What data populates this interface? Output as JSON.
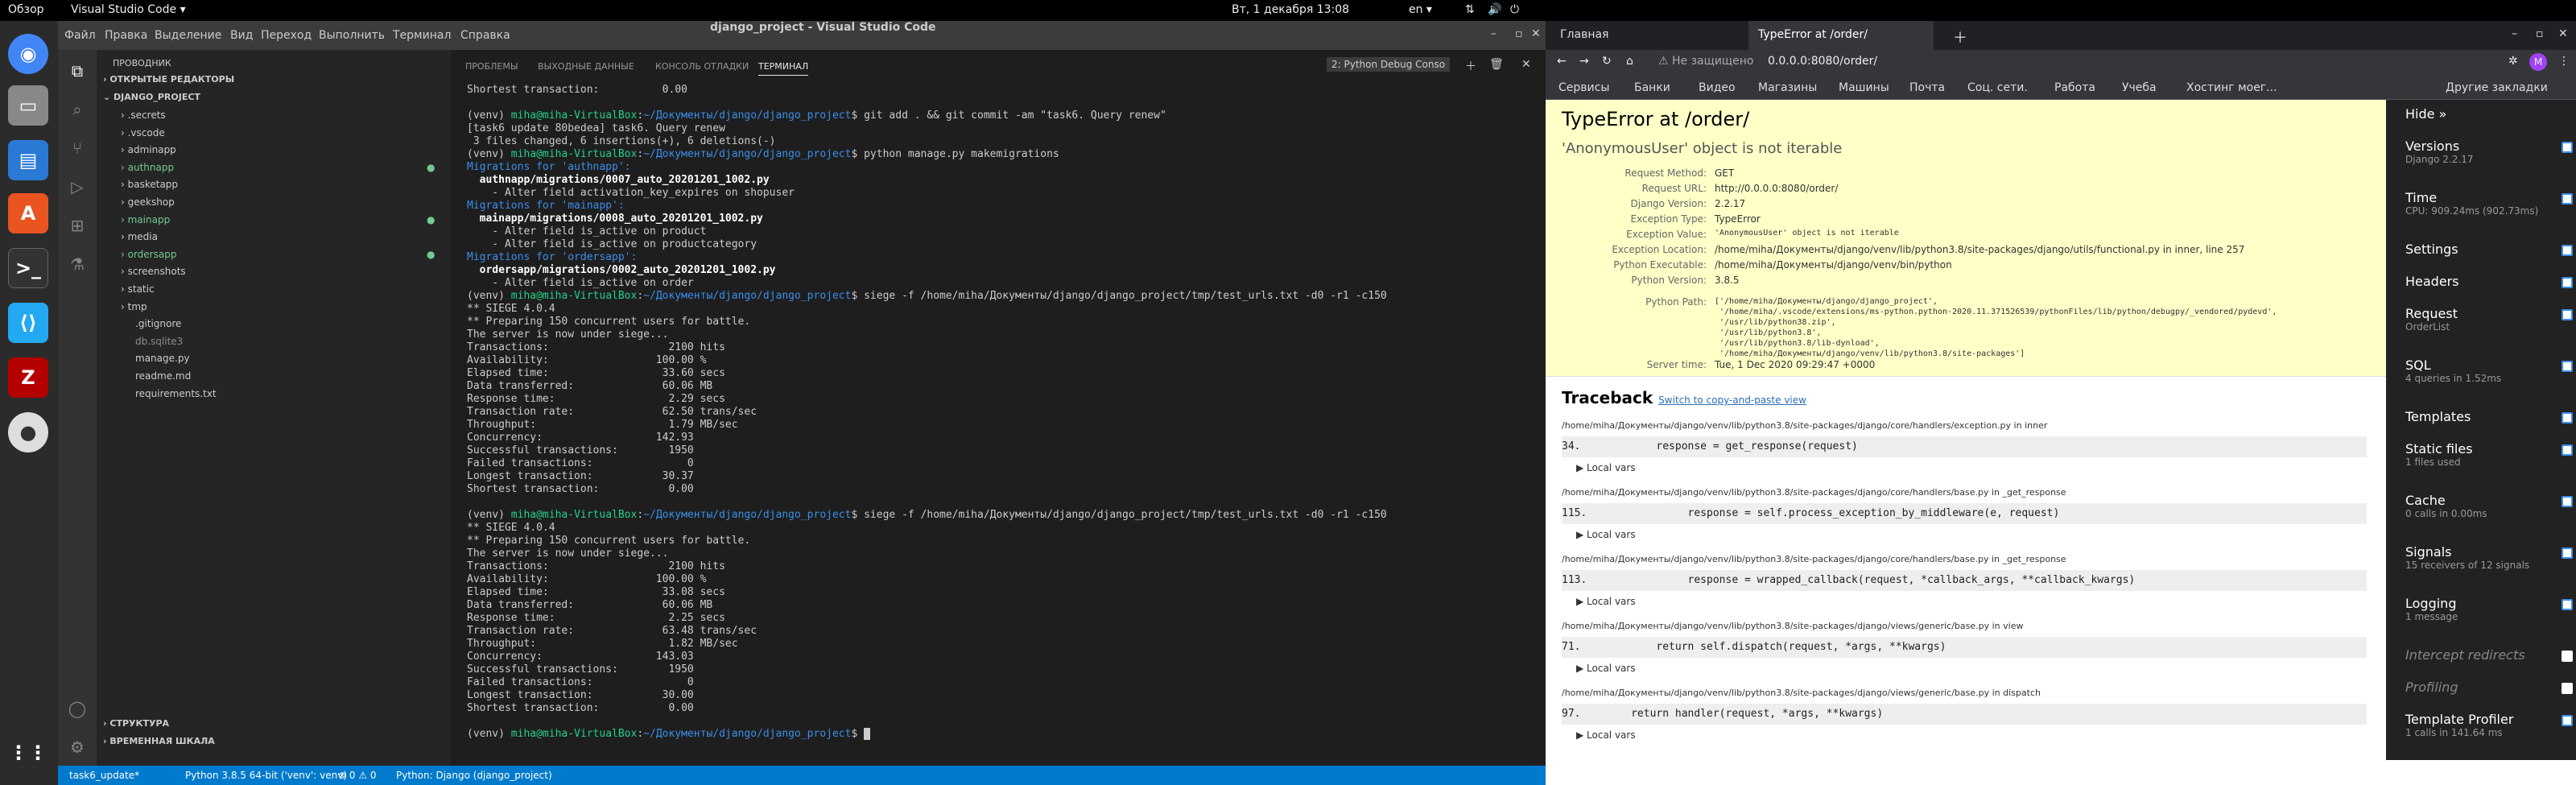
{
  "topbar": {
    "left": "Обзор",
    "app": "Visual Studio Code ▾",
    "clock": "Вт, 1 декабря  13:08",
    "lang": "en ▾"
  },
  "vscode": {
    "title": "django_project - Visual Studio Code",
    "menu": [
      "Файл",
      "Правка",
      "Выделение",
      "Вид",
      "Переход",
      "Выполнить",
      "Терминал",
      "Справка"
    ],
    "explorer_title": "ПРОВОДНИК",
    "open_editors": "ОТКРЫТЫЕ РЕДАКТОРЫ",
    "project": "DJANGO_PROJECT",
    "tree": [
      ".secrets",
      ".vscode",
      "adminapp",
      "authnapp",
      "basketapp",
      "geekshop",
      "mainapp",
      "media",
      "ordersapp",
      "screenshots",
      "static",
      "tmp",
      ".gitignore",
      "db.sqlite3",
      "manage.py",
      "readme.md",
      "requirements.txt"
    ],
    "outline": "СТРУКТУРА",
    "timeline": "ВРЕМЕННАЯ ШКАЛА",
    "panel_tabs": [
      "ПРОБЛЕМЫ",
      "ВЫХОДНЫЕ ДАННЫЕ",
      "КОНСОЛЬ ОТЛАДКИ",
      "ТЕРМИНАЛ"
    ],
    "term_select": "2: Python Debug Conso",
    "terminal_lines": [
      "Shortest transaction:          0.00",
      "",
      "(venv) miha@miha-VirtualBox:~/Документы/django/django_project$ git add . && git commit -am \"task6. Query renew\"",
      "[task6 update 80bedea] task6. Query renew",
      " 3 files changed, 6 insertions(+), 6 deletions(-)",
      "(venv) miha@miha-VirtualBox:~/Документы/django/django_project$ python manage.py makemigrations",
      "Migrations for 'authnapp':",
      "  authnapp/migrations/0007_auto_20201201_1002.py",
      "    - Alter field activation_key_expires on shopuser",
      "Migrations for 'mainapp':",
      "  mainapp/migrations/0008_auto_20201201_1002.py",
      "    - Alter field is_active on product",
      "    - Alter field is_active on productcategory",
      "Migrations for 'ordersapp':",
      "  ordersapp/migrations/0002_auto_20201201_1002.py",
      "    - Alter field is_active on order",
      "(venv) miha@miha-VirtualBox:~/Документы/django/django_project$ siege -f /home/miha/Документы/django/django_project/tmp/test_urls.txt -d0 -r1 -c150",
      "** SIEGE 4.0.4",
      "** Preparing 150 concurrent users for battle.",
      "The server is now under siege...",
      "Transactions:                   2100 hits",
      "Availability:                 100.00 %",
      "Elapsed time:                  33.60 secs",
      "Data transferred:              60.06 MB",
      "Response time:                  2.29 secs",
      "Transaction rate:              62.50 trans/sec",
      "Throughput:                     1.79 MB/sec",
      "Concurrency:                  142.93",
      "Successful transactions:        1950",
      "Failed transactions:               0",
      "Longest transaction:           30.37",
      "Shortest transaction:           0.00",
      "",
      "(venv) miha@miha-VirtualBox:~/Документы/django/django_project$ siege -f /home/miha/Документы/django/django_project/tmp/test_urls.txt -d0 -r1 -c150",
      "** SIEGE 4.0.4",
      "** Preparing 150 concurrent users for battle.",
      "The server is now under siege...",
      "Transactions:                   2100 hits",
      "Availability:                 100.00 %",
      "Elapsed time:                  33.08 secs",
      "Data transferred:              60.06 MB",
      "Response time:                  2.25 secs",
      "Transaction rate:              63.48 trans/sec",
      "Throughput:                     1.82 MB/sec",
      "Concurrency:                  143.03",
      "Successful transactions:        1950",
      "Failed transactions:               0",
      "Longest transaction:           30.00",
      "Shortest transaction:           0.00",
      "",
      "(venv) miha@miha-VirtualBox:~/Документы/django/django_project$ "
    ],
    "status": {
      "branch": "task6_update*",
      "python": "Python 3.8.5 64-bit ('venv': venv)",
      "errors": "⊗ 0 ⚠ 0",
      "debug": "Python: Django (django_project)"
    }
  },
  "chrome": {
    "tab1": "Главная",
    "tab2": "TypeError at /order/",
    "security": "Не защищено",
    "url": "0.0.0.0:8080/order/",
    "bookmarks": [
      "Сервисы",
      "Банки",
      "Видео",
      "Магазины",
      "Машины",
      "Почта",
      "Соц. сети.",
      "Работа",
      "Учеба",
      "Хостинг моег..."
    ],
    "other_bm": "Другие закладки",
    "error_title": "TypeError at /order/",
    "error_msg": "'AnonymousUser' object is not iterable",
    "meta": [
      [
        "Request Method:",
        "GET"
      ],
      [
        "Request URL:",
        "http://0.0.0.0:8080/order/"
      ],
      [
        "Django Version:",
        "2.2.17"
      ],
      [
        "Exception Type:",
        "TypeError"
      ],
      [
        "Exception Value:",
        "'AnonymousUser' object is not iterable"
      ],
      [
        "Exception Location:",
        "/home/miha/Документы/django/venv/lib/python3.8/site-packages/django/utils/functional.py in inner, line 257"
      ],
      [
        "Python Executable:",
        "/home/miha/Документы/django/venv/bin/python"
      ],
      [
        "Python Version:",
        "3.8.5"
      ]
    ],
    "python_path_label": "Python Path:",
    "python_path": "['/home/miha/Документы/django/django_project',\n '/home/miha/.vscode/extensions/ms-python.python-2020.11.371526539/pythonFiles/lib/python/debugpy/_vendored/pydevd',\n '/usr/lib/python38.zip',\n '/usr/lib/python3.8',\n '/usr/lib/python3.8/lib-dynload',\n '/home/miha/Документы/django/venv/lib/python3.8/site-packages']",
    "server_time_label": "Server time:",
    "server_time": "Tue, 1 Dec 2020 09:29:47 +0000",
    "traceback": "Traceback",
    "switch": "Switch to copy-and-paste view",
    "frames": [
      {
        "file": "/home/miha/Документы/django/venv/lib/python3.8/site-packages/django/core/handlers/exception.py in inner",
        "code": "34.            response = get_response(request)"
      },
      {
        "file": "/home/miha/Документы/django/venv/lib/python3.8/site-packages/django/core/handlers/base.py in _get_response",
        "code": "115.                response = self.process_exception_by_middleware(e, request)"
      },
      {
        "file": "/home/miha/Документы/django/venv/lib/python3.8/site-packages/django/core/handlers/base.py in _get_response",
        "code": "113.                response = wrapped_callback(request, *callback_args, **callback_kwargs)"
      },
      {
        "file": "/home/miha/Документы/django/venv/lib/python3.8/site-packages/django/views/generic/base.py in view",
        "code": "71.            return self.dispatch(request, *args, **kwargs)"
      },
      {
        "file": "/home/miha/Документы/django/venv/lib/python3.8/site-packages/django/views/generic/base.py in dispatch",
        "code": "97.        return handler(request, *args, **kwargs)"
      }
    ],
    "local_vars": "▶ Local vars",
    "djdt": [
      {
        "t": "Hide »",
        "s": ""
      },
      {
        "t": "Versions",
        "s": "Django 2.2.17"
      },
      {
        "t": "Time",
        "s": "CPU: 909.24ms (902.73ms)"
      },
      {
        "t": "Settings",
        "s": ""
      },
      {
        "t": "Headers",
        "s": ""
      },
      {
        "t": "Request",
        "s": "OrderList"
      },
      {
        "t": "SQL",
        "s": "4 queries in 1.52ms"
      },
      {
        "t": "Templates",
        "s": ""
      },
      {
        "t": "Static files",
        "s": "1 files used"
      },
      {
        "t": "Cache",
        "s": "0 calls in 0.00ms"
      },
      {
        "t": "Signals",
        "s": "15 receivers of 12 signals"
      },
      {
        "t": "Logging",
        "s": "1 message"
      },
      {
        "t": "Intercept redirects",
        "s": ""
      },
      {
        "t": "Profiling",
        "s": ""
      },
      {
        "t": "Template Profiler",
        "s": "1 calls in 141.64 ms"
      }
    ]
  }
}
